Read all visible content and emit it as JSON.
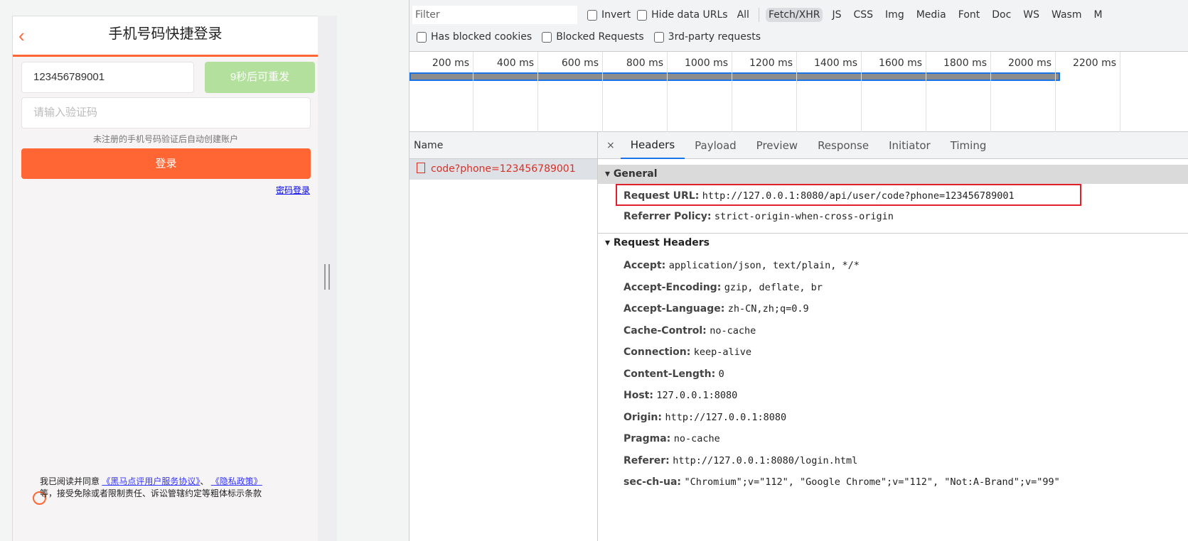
{
  "page": {
    "title": "手机号码快捷登录",
    "phone_value": "123456789001",
    "resend_label": "9秒后可重发",
    "code_placeholder": "请输入验证码",
    "hint": "未注册的手机号码验证后自动创建账户",
    "login_label": "登录",
    "password_login_link": "密码登录",
    "agree_prefix": "我已阅读并同意",
    "agree_link1": "《黑马点评用户服务协议》",
    "agree_sep": "、",
    "agree_link2": "《隐私政策》",
    "agree_suffix": "等，接受免除或者限制责任、诉讼管辖约定等粗体标示条款",
    "accent": "#ff6633"
  },
  "devtools": {
    "filter_placeholder": "Filter",
    "invert": "Invert",
    "hide_data_urls": "Hide data URLs",
    "types": [
      "All",
      "Fetch/XHR",
      "JS",
      "CSS",
      "Img",
      "Media",
      "Font",
      "Doc",
      "WS",
      "Wasm",
      "M"
    ],
    "selected_type": "Fetch/XHR",
    "row2": [
      "Has blocked cookies",
      "Blocked Requests",
      "3rd-party requests"
    ],
    "ticks": [
      "200 ms",
      "400 ms",
      "600 ms",
      "800 ms",
      "1000 ms",
      "1200 ms",
      "1400 ms",
      "1600 ms",
      "1800 ms",
      "2000 ms",
      "2200 ms"
    ],
    "name_header": "Name",
    "request_name": "code?phone=123456789001",
    "close": "×",
    "tabs": [
      "Headers",
      "Payload",
      "Preview",
      "Response",
      "Initiator",
      "Timing"
    ],
    "active_tab": "Headers",
    "general_title": "General",
    "general": [
      {
        "k": "Request URL:",
        "v": "http://127.0.0.1:8080/api/user/code?phone=123456789001"
      },
      {
        "k": "Referrer Policy:",
        "v": "strict-origin-when-cross-origin"
      }
    ],
    "req_headers_title": "Request Headers",
    "headers": [
      {
        "k": "Accept:",
        "v": "application/json, text/plain, */*"
      },
      {
        "k": "Accept-Encoding:",
        "v": "gzip, deflate, br"
      },
      {
        "k": "Accept-Language:",
        "v": "zh-CN,zh;q=0.9"
      },
      {
        "k": "Cache-Control:",
        "v": "no-cache"
      },
      {
        "k": "Connection:",
        "v": "keep-alive"
      },
      {
        "k": "Content-Length:",
        "v": "0"
      },
      {
        "k": "Host:",
        "v": "127.0.0.1:8080"
      },
      {
        "k": "Origin:",
        "v": "http://127.0.0.1:8080"
      },
      {
        "k": "Pragma:",
        "v": "no-cache"
      },
      {
        "k": "Referer:",
        "v": "http://127.0.0.1:8080/login.html"
      },
      {
        "k": "sec-ch-ua:",
        "v": "\"Chromium\";v=\"112\", \"Google Chrome\";v=\"112\", \"Not:A-Brand\";v=\"99\""
      }
    ]
  }
}
